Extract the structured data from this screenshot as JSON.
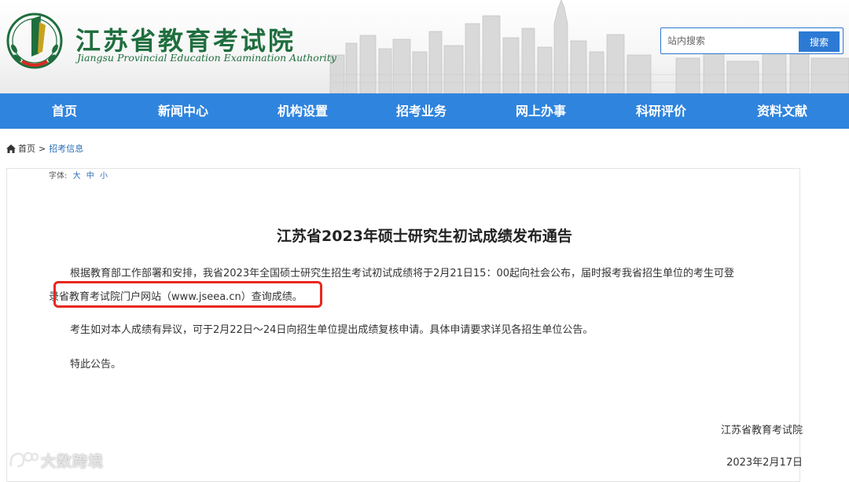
{
  "header": {
    "logo_cn": "江苏省教育考试院",
    "logo_en": "Jiangsu Provincial Education Examination Authority",
    "search": {
      "placeholder": "站内搜索",
      "button_label": "搜索"
    }
  },
  "nav": {
    "items": [
      "首页",
      "新闻中心",
      "机构设置",
      "招考业务",
      "网上办事",
      "科研评价",
      "资料文献"
    ]
  },
  "breadcrumb": {
    "home": "首页",
    "separator": ">",
    "current": "招考信息"
  },
  "font_size": {
    "label": "字体:",
    "options": [
      "大",
      "中",
      "小"
    ]
  },
  "article": {
    "title": "江苏省2023年硕士研究生初试成绩发布通告",
    "para1_line1": "根据教育部工作部署和安排，我省2023年全国硕士研究生招生考试初试成绩将于2月21日15：00起向社会公布，届时报考我省招生单位的考生可登",
    "para1_line2": "录省教育考试院门户网站（www.jseea.cn）查询成绩。",
    "para2": "考生如对本人成绩有异议，可于2月22日～24日向招生单位提出成绩复核申请。具体申请要求详见各招生单位公告。",
    "para3": "特此公告。",
    "signature": "江苏省教育考试院",
    "date": "2023年2月17日"
  },
  "watermark": {
    "text": "大数跨境"
  },
  "colors": {
    "nav_bg": "#2f84dd",
    "logo_green": "#1f6e3e",
    "link_blue": "#2c6fb8",
    "highlight_red": "#e8281e"
  }
}
